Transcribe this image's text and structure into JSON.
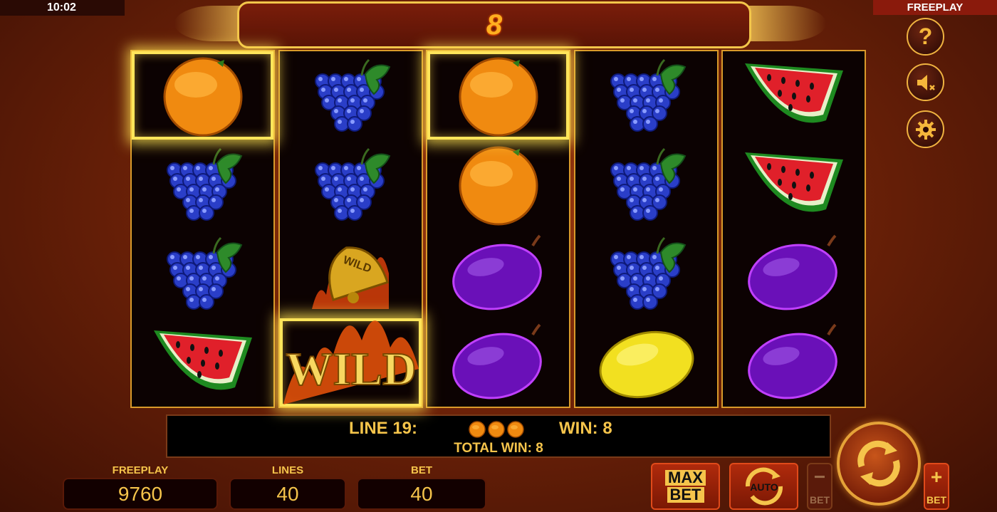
{
  "status": {
    "time": "10:02",
    "mode": "FREEPLAY"
  },
  "top": {
    "win_amount": "8"
  },
  "side_buttons": [
    {
      "name": "help",
      "icon": "question-mark-icon",
      "glyph": "?"
    },
    {
      "name": "sound",
      "icon": "speaker-muted-icon"
    },
    {
      "name": "settings",
      "icon": "gear-icon"
    }
  ],
  "reels": [
    [
      "orange",
      "grapes",
      "grapes",
      "watermelon"
    ],
    [
      "grapes",
      "grapes",
      "bell-wild",
      "wild"
    ],
    [
      "orange",
      "orange",
      "plum",
      "plum"
    ],
    [
      "grapes",
      "grapes",
      "grapes",
      "lemon"
    ],
    [
      "watermelon",
      "watermelon",
      "plum",
      "plum"
    ]
  ],
  "highlighted": [
    [
      0,
      0
    ],
    [
      1,
      3
    ],
    [
      2,
      0
    ]
  ],
  "bell_label": "WILD",
  "wild_label": "WILD",
  "win_info": {
    "line_label": "LINE 19:",
    "win_label": "WIN: 8",
    "total_label": "TOTAL WIN: 8",
    "symbol_count": 3,
    "symbol": "orange"
  },
  "stats": {
    "freeplay": {
      "label": "FREEPLAY",
      "value": "9760"
    },
    "lines": {
      "label": "LINES",
      "value": "40"
    },
    "bet": {
      "label": "BET",
      "value": "40"
    }
  },
  "controls": {
    "max_bet_line1": "MAX",
    "max_bet_line2": "BET",
    "auto_label": "AUTO",
    "bet_minus_sign": "−",
    "bet_minus_label": "BET",
    "bet_plus_sign": "+",
    "bet_plus_label": "BET"
  },
  "colors": {
    "accent": "#f5c44b",
    "highlight": "#ffe55a",
    "background": "#7a2408"
  }
}
